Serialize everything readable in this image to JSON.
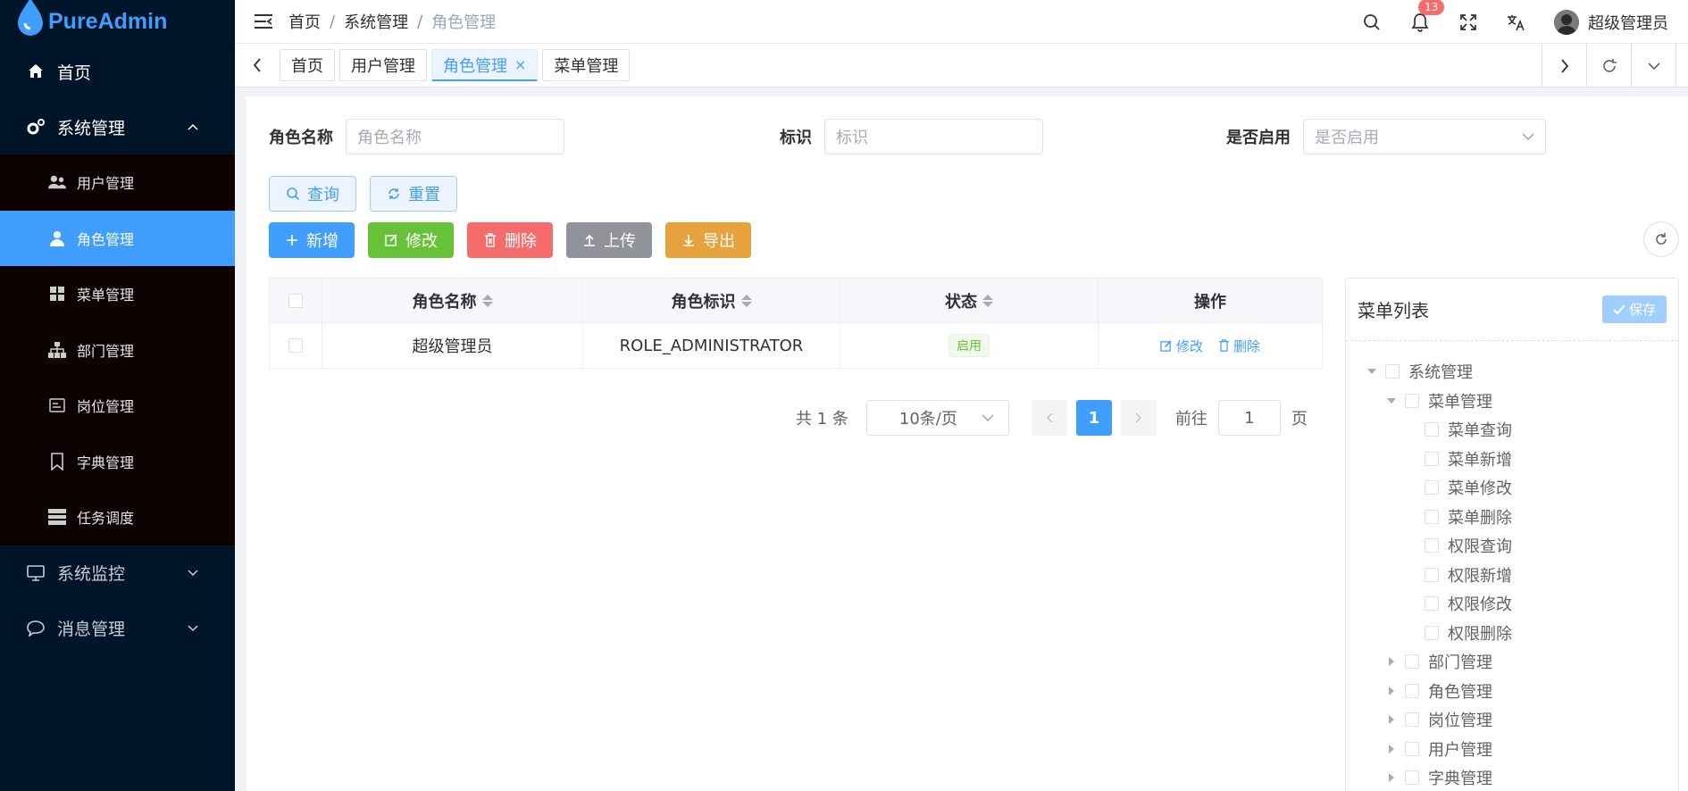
{
  "app": {
    "name": "PureAdmin"
  },
  "sidebar": {
    "home": "首页",
    "system": "系统管理",
    "sub": [
      {
        "label": "用户管理",
        "icon": "users-icon"
      },
      {
        "label": "角色管理",
        "icon": "role-icon"
      },
      {
        "label": "菜单管理",
        "icon": "grid-icon"
      },
      {
        "label": "部门管理",
        "icon": "org-icon"
      },
      {
        "label": "岗位管理",
        "icon": "card-icon"
      },
      {
        "label": "字典管理",
        "icon": "bookmark-icon"
      },
      {
        "label": "任务调度",
        "icon": "server-icon"
      }
    ],
    "monitor": "系统监控",
    "message": "消息管理"
  },
  "header": {
    "breadcrumb": [
      "首页",
      "系统管理",
      "角色管理"
    ],
    "notifications": "13",
    "username": "超级管理员"
  },
  "tabs": [
    "首页",
    "用户管理",
    "角色管理",
    "菜单管理"
  ],
  "tab_close": "×",
  "filters": {
    "name_label": "角色名称",
    "name_placeholder": "角色名称",
    "code_label": "标识",
    "code_placeholder": "标识",
    "enabled_label": "是否启用",
    "enabled_placeholder": "是否启用"
  },
  "buttons": {
    "search": "查询",
    "reset": "重置",
    "add": "新增",
    "edit": "修改",
    "delete": "删除",
    "upload": "上传",
    "export": "导出"
  },
  "table": {
    "headers": [
      "角色名称",
      "角色标识",
      "状态",
      "操作"
    ],
    "rows": [
      {
        "name": "超级管理员",
        "code": "ROLE_ADMINISTRATOR",
        "status": "启用",
        "edit": "修改",
        "delete": "删除"
      }
    ]
  },
  "pagination": {
    "total": "共 1 条",
    "page_size": "10条/页",
    "current": "1",
    "goto_label": "前往",
    "goto_value": "1",
    "page_suffix": "页"
  },
  "menu_tree": {
    "title": "菜单列表",
    "save": "保存",
    "nodes": [
      {
        "label": "系统管理",
        "level": 0,
        "state": "expanded"
      },
      {
        "label": "菜单管理",
        "level": 1,
        "state": "expanded"
      },
      {
        "label": "菜单查询",
        "level": 2,
        "state": "leaf"
      },
      {
        "label": "菜单新增",
        "level": 2,
        "state": "leaf"
      },
      {
        "label": "菜单修改",
        "level": 2,
        "state": "leaf"
      },
      {
        "label": "菜单删除",
        "level": 2,
        "state": "leaf"
      },
      {
        "label": "权限查询",
        "level": 2,
        "state": "leaf"
      },
      {
        "label": "权限新增",
        "level": 2,
        "state": "leaf"
      },
      {
        "label": "权限修改",
        "level": 2,
        "state": "leaf"
      },
      {
        "label": "权限删除",
        "level": 2,
        "state": "leaf"
      },
      {
        "label": "部门管理",
        "level": 1,
        "state": "collapsed"
      },
      {
        "label": "角色管理",
        "level": 1,
        "state": "collapsed"
      },
      {
        "label": "岗位管理",
        "level": 1,
        "state": "collapsed"
      },
      {
        "label": "用户管理",
        "level": 1,
        "state": "collapsed"
      },
      {
        "label": "字典管理",
        "level": 1,
        "state": "collapsed"
      }
    ]
  },
  "colors": {
    "primary": "#409eff",
    "sidebar": "#001529",
    "submenu": "#0c0202"
  }
}
